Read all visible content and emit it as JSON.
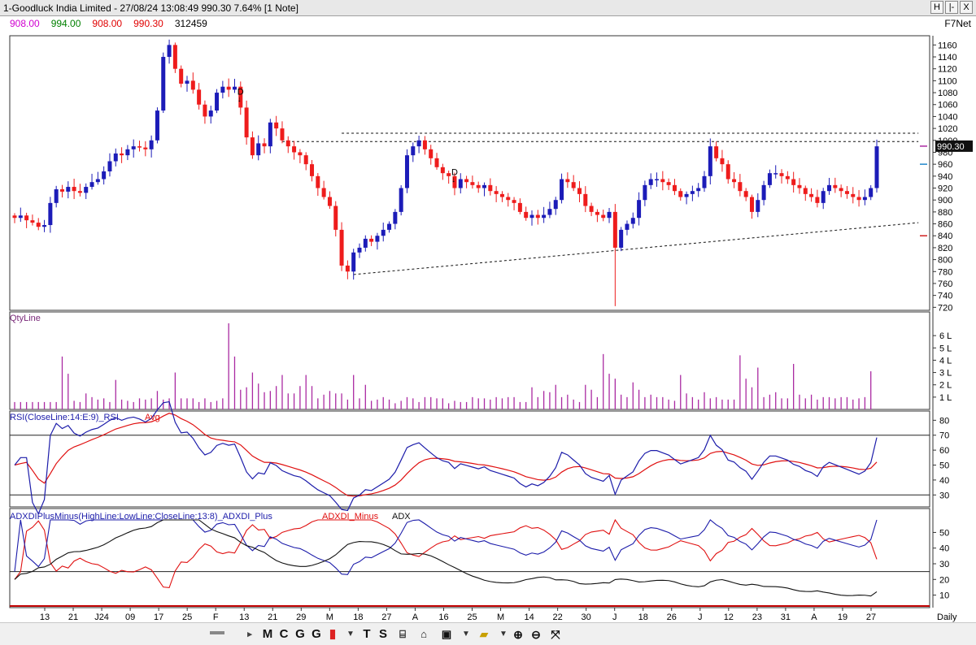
{
  "window": {
    "title": "1-Goodluck India Limited - 27/08/24 13:08:49 990.30 7.64% [1 Note]",
    "buttons": [
      "H",
      "|-",
      "X"
    ]
  },
  "ohlc_row": {
    "open": "908.00",
    "high": "994.00",
    "low": "908.00",
    "close": "990.30",
    "volume": "312459",
    "open_color": "#d000d0",
    "high_color": "#008000",
    "low_color": "#e00000",
    "close_color": "#e00000"
  },
  "provider": "F7Net",
  "chart_data": [
    {
      "type": "candlestick",
      "yticks": [
        720,
        740,
        760,
        780,
        800,
        820,
        840,
        860,
        880,
        900,
        920,
        940,
        960,
        980,
        1000,
        1020,
        1040,
        1060,
        1080,
        1100,
        1120,
        1140,
        1160
      ],
      "ylim": [
        715,
        1170
      ],
      "last_price_label": "990.30",
      "x_labels": [
        "13",
        "21",
        "J24",
        "09",
        "17",
        "25",
        "F",
        "13",
        "21",
        "29",
        "M",
        "18",
        "27",
        "A",
        "16",
        "25",
        "M",
        "14",
        "22",
        "30",
        "J",
        "18",
        "26",
        "J",
        "12",
        "23",
        "31",
        "A",
        "19",
        "27"
      ],
      "right_label": "Daily",
      "annotations": [
        {
          "text": "D",
          "x_index": 38
        },
        {
          "text": "D",
          "x_index": 74
        }
      ],
      "reference_lines": [
        {
          "style": "dashed",
          "from": [
            55,
            1012
          ],
          "to": [
            152,
            1012
          ]
        },
        {
          "style": "dashed",
          "from": [
            45,
            998
          ],
          "to": [
            152,
            998
          ]
        },
        {
          "style": "dashed",
          "from": [
            57,
            775
          ],
          "to": [
            152,
            862
          ]
        }
      ],
      "up_color": "#1c1cb8",
      "down_color": "#ee1c1c",
      "closes": [
        870,
        874,
        866,
        862,
        855,
        858,
        895,
        918,
        914,
        922,
        915,
        912,
        922,
        930,
        935,
        948,
        965,
        978,
        975,
        985,
        990,
        988,
        985,
        1000,
        1050,
        1140,
        1160,
        1120,
        1095,
        1100,
        1085,
        1060,
        1040,
        1050,
        1080,
        1090,
        1085,
        1090,
        1055,
        1005,
        975,
        995,
        990,
        1030,
        1020,
        1000,
        990,
        980,
        975,
        960,
        940,
        920,
        905,
        890,
        850,
        790,
        780,
        812,
        820,
        835,
        830,
        840,
        850,
        860,
        880,
        920,
        975,
        990,
        1000,
        985,
        970,
        955,
        945,
        940,
        920,
        935,
        930,
        925,
        920,
        925,
        915,
        910,
        905,
        900,
        895,
        880,
        870,
        875,
        870,
        875,
        885,
        900,
        935,
        930,
        920,
        910,
        890,
        880,
        875,
        870,
        880,
        820,
        850,
        860,
        870,
        900,
        925,
        935,
        935,
        930,
        925,
        915,
        905,
        910,
        915,
        920,
        940,
        990,
        970,
        960,
        935,
        930,
        915,
        905,
        880,
        900,
        925,
        945,
        945,
        940,
        935,
        925,
        920,
        910,
        905,
        895,
        915,
        925,
        920,
        915,
        910,
        905,
        900,
        905,
        920,
        990
      ],
      "opens_rule": "each candle opens at previous close"
    },
    {
      "type": "bar",
      "title": "QtyLine",
      "yticks": [
        "1 L",
        "2 L",
        "3 L",
        "4 L",
        "5 L",
        "6 L"
      ],
      "unit": "lakh shares",
      "ylim": [
        0,
        7
      ],
      "color": "#aa2aa2",
      "values": [
        0.6,
        0.6,
        0.6,
        0.6,
        0.6,
        0.6,
        0.6,
        0.6,
        4.3,
        2.9,
        0.7,
        0.6,
        1.3,
        1.0,
        0.8,
        0.9,
        0.6,
        2.4,
        0.8,
        0.7,
        0.6,
        0.9,
        0.8,
        0.9,
        1.5,
        0.8,
        0.9,
        3.0,
        0.9,
        0.9,
        0.9,
        0.6,
        0.9,
        0.6,
        0.7,
        0.9,
        7.0,
        4.3,
        1.6,
        1.8,
        3.0,
        2.1,
        1.4,
        1.5,
        1.9,
        2.8,
        1.3,
        1.3,
        1.9,
        2.8,
        1.9,
        0.9,
        1.2,
        1.5,
        1.3,
        1.3,
        0.8,
        2.8,
        0.9,
        2.0,
        0.7,
        0.8,
        1.0,
        0.8,
        0.5,
        0.7,
        1.0,
        0.9,
        0.6,
        1.0,
        1.0,
        0.9,
        0.9,
        0.5,
        0.7,
        0.6,
        0.6,
        1.0,
        0.9,
        0.9,
        0.8,
        1.0,
        0.9,
        1.0,
        1.0,
        0.6,
        0.6,
        1.8,
        1.0,
        1.5,
        1.4,
        2.0,
        1.0,
        1.2,
        0.8,
        0.6,
        2.0,
        1.6,
        1.0,
        4.5,
        2.9,
        2.5,
        1.2,
        1.0,
        2.2,
        1.6,
        1.0,
        1.2,
        1.0,
        1.0,
        0.8,
        0.7,
        2.8,
        1.3,
        1.0,
        0.8,
        1.4,
        0.9,
        1.0,
        0.8,
        0.8,
        0.8,
        4.4,
        2.5,
        1.8,
        3.4,
        1.0,
        1.2,
        1.4,
        0.9,
        0.9,
        3.7,
        1.2,
        0.9,
        1.2,
        0.8,
        1.0,
        1.0,
        0.9,
        1.0,
        1.0,
        0.8,
        0.9,
        1.0,
        3.1
      ]
    },
    {
      "type": "line",
      "title": "RSI(CloseLine:14:E:9)_RSI",
      "legend": [
        {
          "name": "RSI",
          "color": "#1c1caa"
        },
        {
          "name": "Avg",
          "color": "#e01010"
        }
      ],
      "yticks": [
        30,
        40,
        50,
        60,
        70,
        80
      ],
      "ylim": [
        22,
        84
      ],
      "hlines": [
        70,
        30
      ]
    },
    {
      "type": "line",
      "title": "ADXDIPlusMinus(HighLine:LowLine:CloseLine:13:8)_ADXDI_Plus",
      "legend": [
        {
          "name": "ADXDI_Minus",
          "color": "#e01010"
        },
        {
          "name": "ADX",
          "color": "#111111"
        }
      ],
      "plus_color": "#1c1caa",
      "yticks": [
        10,
        20,
        30,
        40,
        50
      ],
      "ylim": [
        2,
        58
      ],
      "hlines": [
        25
      ]
    }
  ],
  "toolbar": {
    "buttons": [
      "M",
      "C",
      "G",
      "T",
      "S"
    ]
  }
}
